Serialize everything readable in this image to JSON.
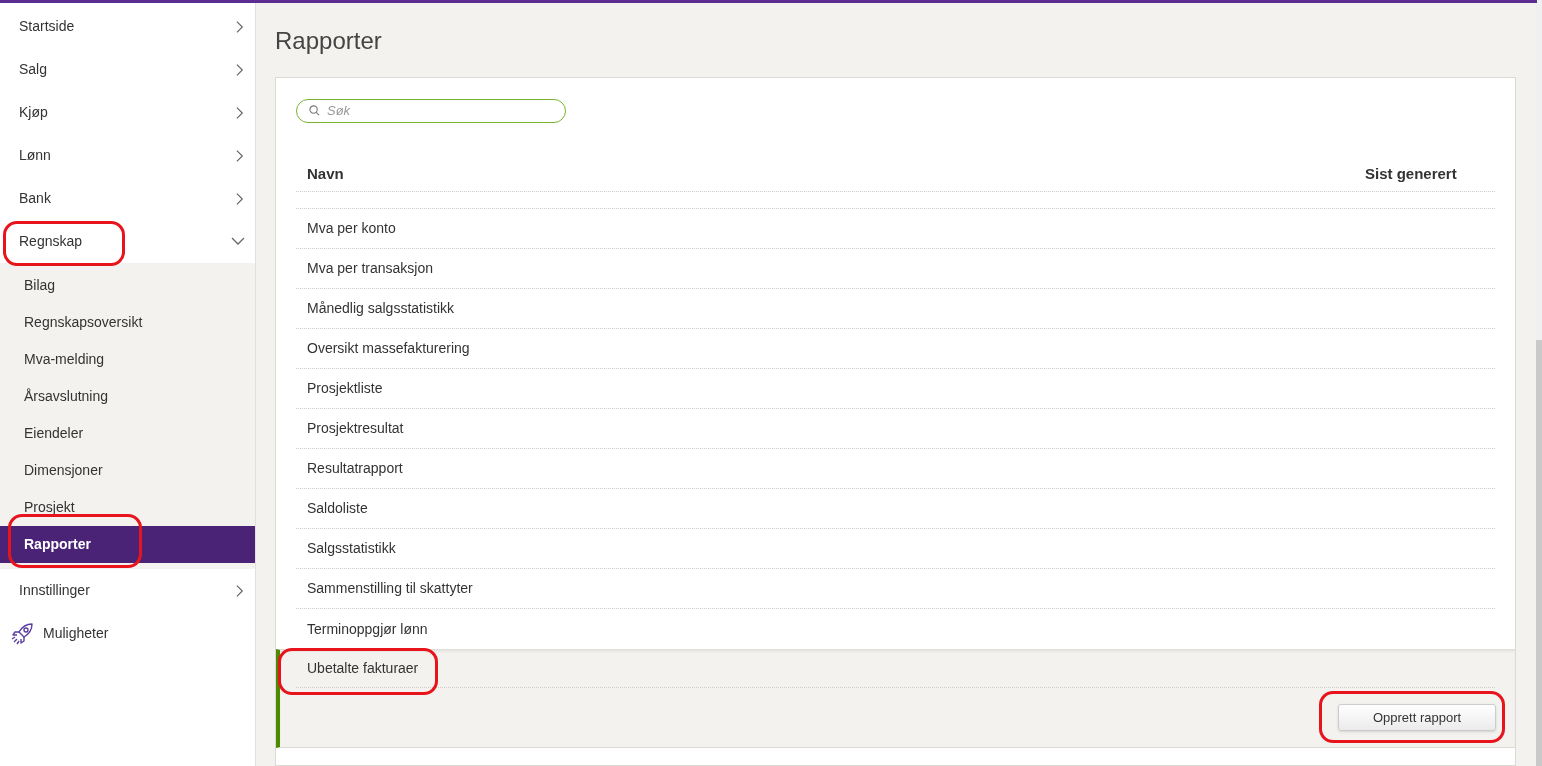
{
  "sidebar": {
    "items": [
      {
        "label": "Startside",
        "kind": "group",
        "expanded": false
      },
      {
        "label": "Salg",
        "kind": "group",
        "expanded": false
      },
      {
        "label": "Kjøp",
        "kind": "group",
        "expanded": false
      },
      {
        "label": "Lønn",
        "kind": "group",
        "expanded": false
      },
      {
        "label": "Bank",
        "kind": "group",
        "expanded": false
      },
      {
        "label": "Regnskap",
        "kind": "group",
        "expanded": true,
        "annotated": true,
        "children": [
          {
            "label": "Bilag",
            "selected": false
          },
          {
            "label": "Regnskapsoversikt",
            "selected": false
          },
          {
            "label": "Mva-melding",
            "selected": false
          },
          {
            "label": "Årsavslutning",
            "selected": false
          },
          {
            "label": "Eiendeler",
            "selected": false
          },
          {
            "label": "Dimensjoner",
            "selected": false
          },
          {
            "label": "Prosjekt",
            "selected": false
          },
          {
            "label": "Rapporter",
            "selected": true,
            "annotated": true
          }
        ]
      },
      {
        "label": "Innstillinger",
        "kind": "group",
        "expanded": false
      },
      {
        "label": "Muligheter",
        "kind": "promo"
      }
    ]
  },
  "page": {
    "title": "Rapporter"
  },
  "search": {
    "placeholder": "Søk"
  },
  "table": {
    "columns": [
      "Navn",
      "Sist generert"
    ],
    "rows": [
      {
        "name": "Mva per konto",
        "selected": false
      },
      {
        "name": "Mva per transaksjon",
        "selected": false
      },
      {
        "name": "Månedlig salgsstatistikk",
        "selected": false
      },
      {
        "name": "Oversikt massefakturering",
        "selected": false
      },
      {
        "name": "Prosjektliste",
        "selected": false
      },
      {
        "name": "Prosjektresultat",
        "selected": false
      },
      {
        "name": "Resultatrapport",
        "selected": false
      },
      {
        "name": "Saldoliste",
        "selected": false
      },
      {
        "name": "Salgsstatistikk",
        "selected": false
      },
      {
        "name": "Sammenstilling til skattyter",
        "selected": false
      },
      {
        "name": "Terminoppgjør lønn",
        "selected": false
      },
      {
        "name": "Ubetalte fakturaer",
        "selected": true,
        "annotated": true
      }
    ],
    "detail_button": {
      "label": "Opprett rapport",
      "annotated": true
    }
  }
}
